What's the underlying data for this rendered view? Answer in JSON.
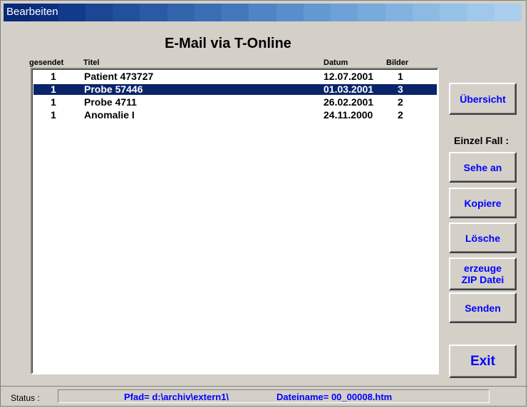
{
  "window": {
    "title": "Bearbeiten",
    "heading": "E-Mail via T-Online",
    "titlebar_colors": [
      "#082878",
      "#0c2e80",
      "#123a8a",
      "#1a4694",
      "#22509c",
      "#2a5aa4",
      "#3264ac",
      "#3a6eb4",
      "#4478bc",
      "#5084c4",
      "#5a8eca",
      "#6498d0",
      "#6ea2d6",
      "#78aadb",
      "#82b2df",
      "#8cbae3",
      "#96c2e7",
      "#a0c8ea",
      "#aaceed"
    ]
  },
  "columns": {
    "sent": "gesendet",
    "title": "Titel",
    "date": "Datum",
    "pictures": "Bilder"
  },
  "rows": [
    {
      "sent": "1",
      "title": "Patient 473727",
      "date": "12.07.2001",
      "pictures": "1",
      "selected": false
    },
    {
      "sent": "1",
      "title": "Probe 57446",
      "date": "01.03.2001",
      "pictures": "3",
      "selected": true
    },
    {
      "sent": "1",
      "title": "Probe 4711",
      "date": "26.02.2001",
      "pictures": "2",
      "selected": false
    },
    {
      "sent": "1",
      "title": "Anomalie I",
      "date": "24.11.2000",
      "pictures": "2",
      "selected": false
    }
  ],
  "buttons": {
    "overview": "Übersicht",
    "single_case_label": "Einzel Fall :",
    "view": "Sehe an",
    "copy": "Kopiere",
    "delete": "Lösche",
    "zip_line1": "erzeuge",
    "zip_line2": "ZIP Datei",
    "send": "Senden",
    "exit": "Exit"
  },
  "status": {
    "label": "Status :",
    "path": "Pfad= d:\\archiv\\extern1\\",
    "filename": "Dateiname= 00_00008.htm"
  },
  "colors": {
    "accent_text": "#0000ff",
    "selection": "#0a246a",
    "face": "#d4d0c8"
  }
}
